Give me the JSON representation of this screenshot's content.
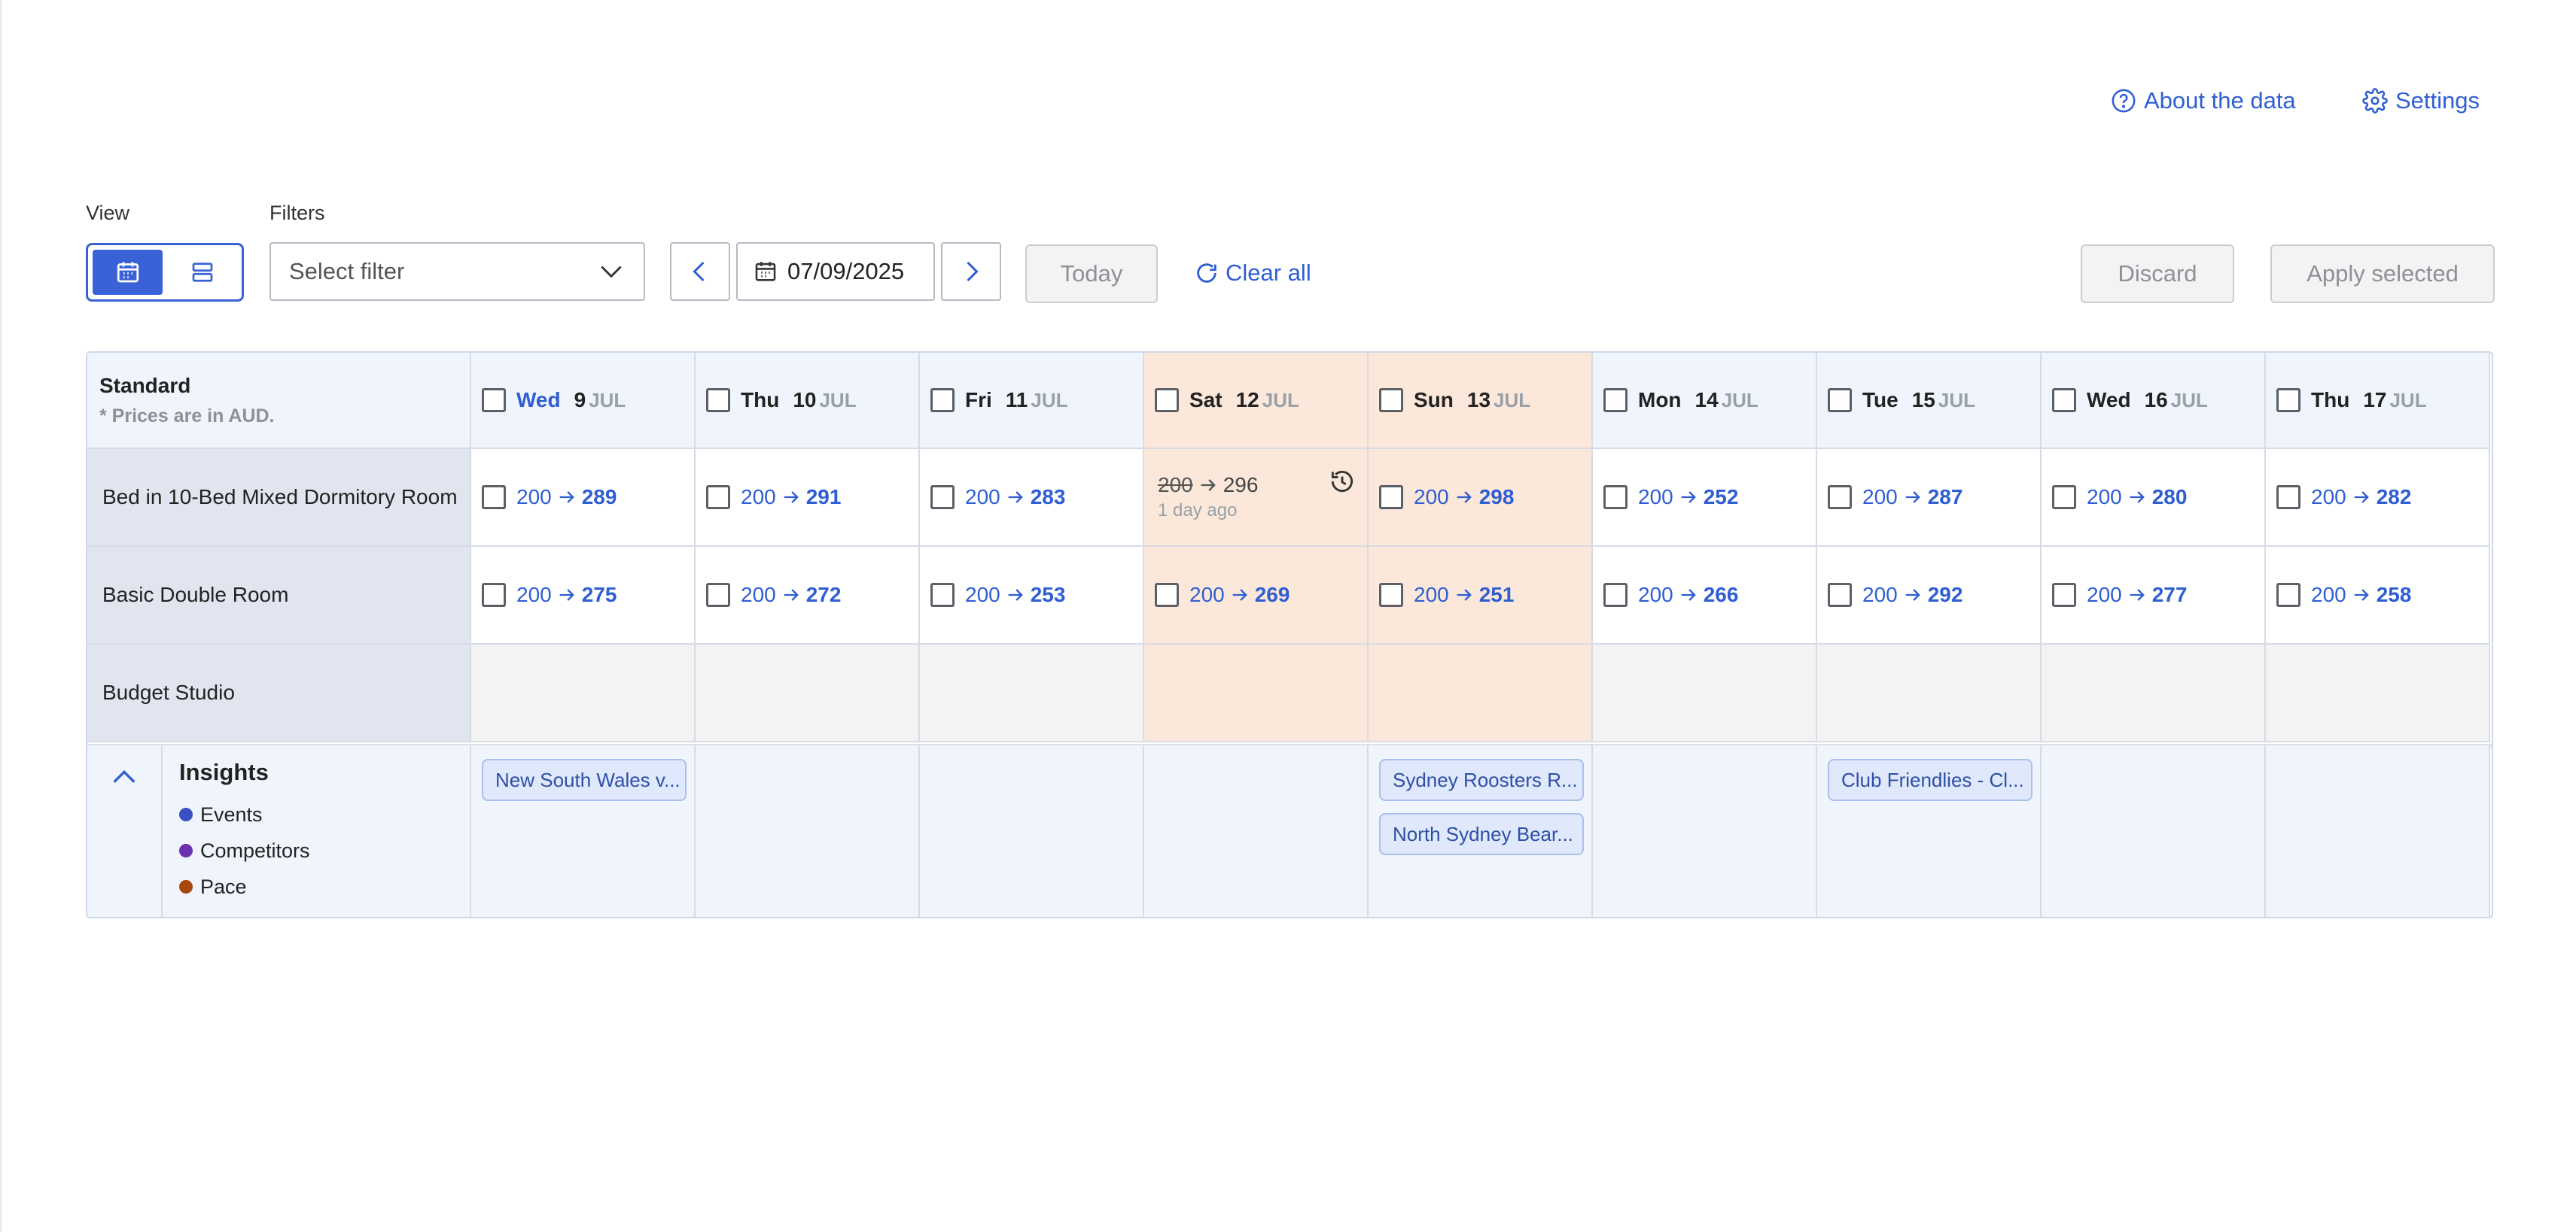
{
  "top_links": {
    "about": "About the data",
    "settings": "Settings"
  },
  "toolbar": {
    "view_label": "View",
    "filters_label": "Filters",
    "filter_placeholder": "Select filter",
    "date": "07/09/2025",
    "today": "Today",
    "clear_all": "Clear all",
    "discard": "Discard",
    "apply": "Apply selected"
  },
  "table": {
    "title": "Standard",
    "subtitle": "* Prices are in AUD.",
    "days": [
      {
        "name": "Wed",
        "num": "9",
        "mon": "JUL",
        "today": true,
        "weekend": false
      },
      {
        "name": "Thu",
        "num": "10",
        "mon": "JUL",
        "today": false,
        "weekend": false
      },
      {
        "name": "Fri",
        "num": "11",
        "mon": "JUL",
        "today": false,
        "weekend": false
      },
      {
        "name": "Sat",
        "num": "12",
        "mon": "JUL",
        "today": false,
        "weekend": true
      },
      {
        "name": "Sun",
        "num": "13",
        "mon": "JUL",
        "today": false,
        "weekend": true
      },
      {
        "name": "Mon",
        "num": "14",
        "mon": "JUL",
        "today": false,
        "weekend": false
      },
      {
        "name": "Tue",
        "num": "15",
        "mon": "JUL",
        "today": false,
        "weekend": false
      },
      {
        "name": "Wed",
        "num": "16",
        "mon": "JUL",
        "today": false,
        "weekend": false
      },
      {
        "name": "Thu",
        "num": "17",
        "mon": "JUL",
        "today": false,
        "weekend": false
      }
    ],
    "rooms": [
      {
        "name": "Bed in 10-Bed Mixed Dormitory Room",
        "prices": [
          {
            "old": "200",
            "new": "289"
          },
          {
            "old": "200",
            "new": "291"
          },
          {
            "old": "200",
            "new": "283"
          },
          {
            "old": "200",
            "new": "296",
            "applied": true,
            "ago": "1 day ago"
          },
          {
            "old": "200",
            "new": "298"
          },
          {
            "old": "200",
            "new": "252"
          },
          {
            "old": "200",
            "new": "287"
          },
          {
            "old": "200",
            "new": "280"
          },
          {
            "old": "200",
            "new": "282"
          }
        ]
      },
      {
        "name": "Basic Double Room",
        "prices": [
          {
            "old": "200",
            "new": "275"
          },
          {
            "old": "200",
            "new": "272"
          },
          {
            "old": "200",
            "new": "253"
          },
          {
            "old": "200",
            "new": "269"
          },
          {
            "old": "200",
            "new": "251"
          },
          {
            "old": "200",
            "new": "266"
          },
          {
            "old": "200",
            "new": "292"
          },
          {
            "old": "200",
            "new": "277"
          },
          {
            "old": "200",
            "new": "258"
          }
        ]
      },
      {
        "name": "Budget Studio",
        "prices": []
      }
    ]
  },
  "insights": {
    "title": "Insights",
    "legend": [
      {
        "label": "Events",
        "color": "#3b4fc4"
      },
      {
        "label": "Competitors",
        "color": "#6b2fb0"
      },
      {
        "label": "Pace",
        "color": "#a8460f"
      }
    ],
    "events": [
      {
        "day": 0,
        "label": "New South Wales v..."
      },
      {
        "day": 4,
        "label": "Sydney Roosters R..."
      },
      {
        "day": 4,
        "label": "North Sydney Bear..."
      },
      {
        "day": 6,
        "label": "Club Friendlies - Cl..."
      }
    ]
  }
}
